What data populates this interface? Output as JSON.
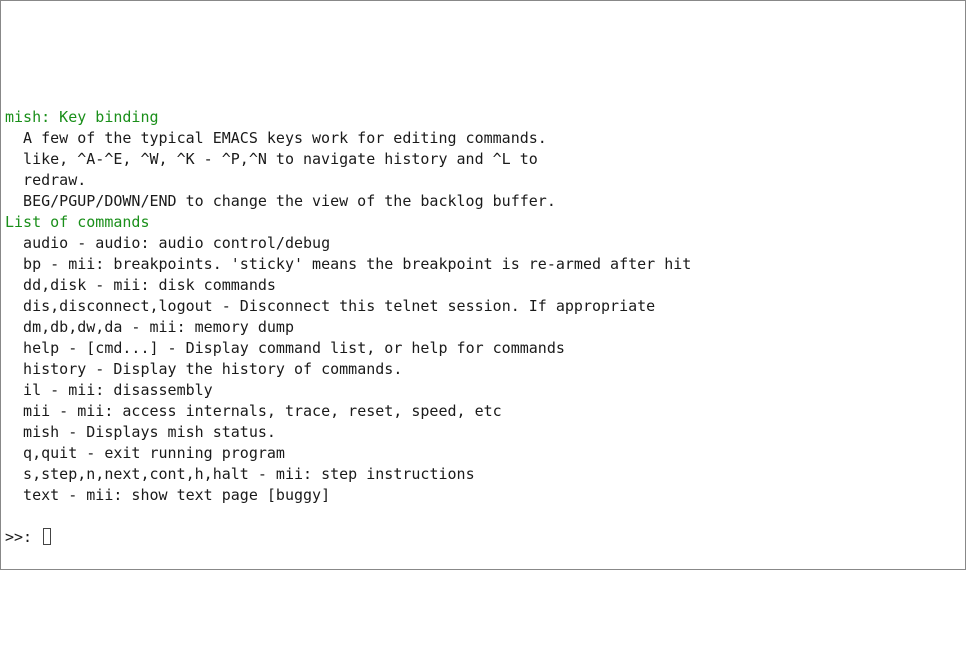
{
  "section1": {
    "title": "mish: Key binding",
    "lines": [
      "A few of the typical EMACS keys work for editing commands.",
      "like, ^A-^E, ^W, ^K - ^P,^N to navigate history and ^L to",
      "redraw.",
      "BEG/PGUP/DOWN/END to change the view of the backlog buffer."
    ]
  },
  "section2": {
    "title": "List of commands",
    "commands": [
      {
        "name": "audio",
        "desc": "audio: audio control/debug"
      },
      {
        "name": "bp",
        "desc": "mii: breakpoints. 'sticky' means the breakpoint is re-armed after hit"
      },
      {
        "name": "dd,disk",
        "desc": "mii: disk commands"
      },
      {
        "name": "dis,disconnect,logout",
        "desc": "Disconnect this telnet session. If appropriate"
      },
      {
        "name": "dm,db,dw,da",
        "desc": "mii: memory dump"
      },
      {
        "name": "help - [cmd...]",
        "desc": "Display command list, or help for commands"
      },
      {
        "name": "history",
        "desc": "Display the history of commands."
      },
      {
        "name": "il",
        "desc": "mii: disassembly"
      },
      {
        "name": "mii",
        "desc": "mii: access internals, trace, reset, speed, etc"
      },
      {
        "name": "mish",
        "desc": "Displays mish status."
      },
      {
        "name": "q,quit",
        "desc": "exit running program"
      },
      {
        "name": "s,step,n,next,cont,h,halt",
        "desc": "mii: step instructions"
      },
      {
        "name": "text",
        "desc": "mii: show text page [buggy]"
      }
    ]
  },
  "prompt": ">>: "
}
